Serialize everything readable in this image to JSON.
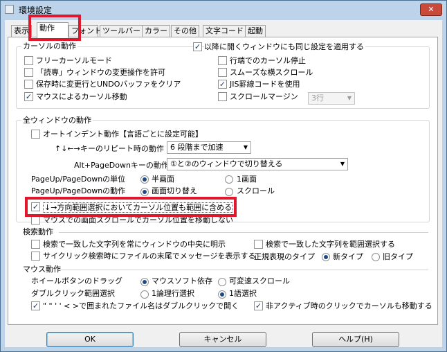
{
  "title": "環境設定",
  "close_symbol": "✕",
  "tabs": [
    "表示",
    "動作",
    "フォント",
    "ツールバー",
    "カラー",
    "その他",
    "文字コード",
    "起動"
  ],
  "cursor_group": {
    "label": "カーソルの動作",
    "items": {
      "free_cursor": "フリーカーソルモード",
      "readonly_window_ops": "「読専」ウィンドウの変更操作を許可",
      "clear_undo_on_save": "保存時に変更行とUNDOバッファをクリア",
      "mouse_cursor_move": "マウスによるカーソル移動",
      "apply_to_new_windows": "以降に開くウィンドウにも同じ設定を適用する",
      "stop_at_line_end": "行端でのカーソル停止",
      "smooth_hscroll": "スムーズな横スクロール",
      "jis_border_code": "JIS罫線コードを使用",
      "scroll_margin": "スクロールマージン"
    },
    "scroll_margin_value": "3行"
  },
  "window_section": {
    "label": "全ウィンドウの動作",
    "auto_indent": "オートインデント動作【言語ごとに設定可能】",
    "arrow_repeat_label": "↑↓←→キーのリピート時の動作",
    "arrow_repeat_value": "6 段階まで加速",
    "alt_pagedown_label": "Alt+PageDownキーの動作",
    "alt_pagedown_value": "①と②のウィンドウで切り替える",
    "pageupdown_unit_label": "PageUp/PageDownの単位",
    "unit_half": "半画面",
    "unit_full": "1画面",
    "pageupdown_action_label": "PageUp/PageDownの動作",
    "action_switch": "画面切り替え",
    "action_scroll": "スクロール",
    "select_include_cursor": "↓→方向範囲選択においてカーソル位置も範囲に含める",
    "mouse_scroll_no_move": "マウスでの画面スクロールでカーソル位置を移動しない"
  },
  "search_section": {
    "label": "検索動作",
    "center_match": "検索で一致した文字列を常にウィンドウの中央に明示",
    "select_match": "検索で一致した文字列を範囲選択する",
    "cyclic_message": "サイクリック検索時にファイルの末尾でメッセージを表示する",
    "regex_type_label": "正規表現のタイプ",
    "regex_new": "新タイプ",
    "regex_old": "旧タイプ"
  },
  "mouse_section": {
    "label": "マウス動作",
    "wheel_drag_label": "ホイールボタンのドラッグ",
    "wheel_mousesoft": "マウスソフト依存",
    "wheel_variable": "可変速スクロール",
    "dblclick_label": "ダブルクリック範囲選択",
    "dbl_logical_line": "1論理行選択",
    "dbl_word": "1語選択",
    "dbl_open_file": "\" \" ' ' < >で囲まれたファイル名はダブルクリックで開く",
    "inactive_click_move": "非アクティブ時のクリックでカーソルも移動する"
  },
  "buttons": {
    "ok": "OK",
    "cancel": "キャンセル",
    "help": "ヘルプ(H)"
  },
  "state": {
    "free_cursor": false,
    "readonly_window_ops": false,
    "clear_undo_on_save": false,
    "mouse_cursor_move": true,
    "apply_to_new_windows": true,
    "stop_at_line_end": false,
    "smooth_hscroll": false,
    "jis_border_code": true,
    "scroll_margin": false,
    "auto_indent": false,
    "select_include_cursor": true,
    "mouse_scroll_no_move": false,
    "center_match": false,
    "select_match": false,
    "cyclic_message": false,
    "dbl_open_file": true,
    "inactive_click_move": true
  },
  "check_mark": "✓",
  "highlight_color": "#e0182e"
}
